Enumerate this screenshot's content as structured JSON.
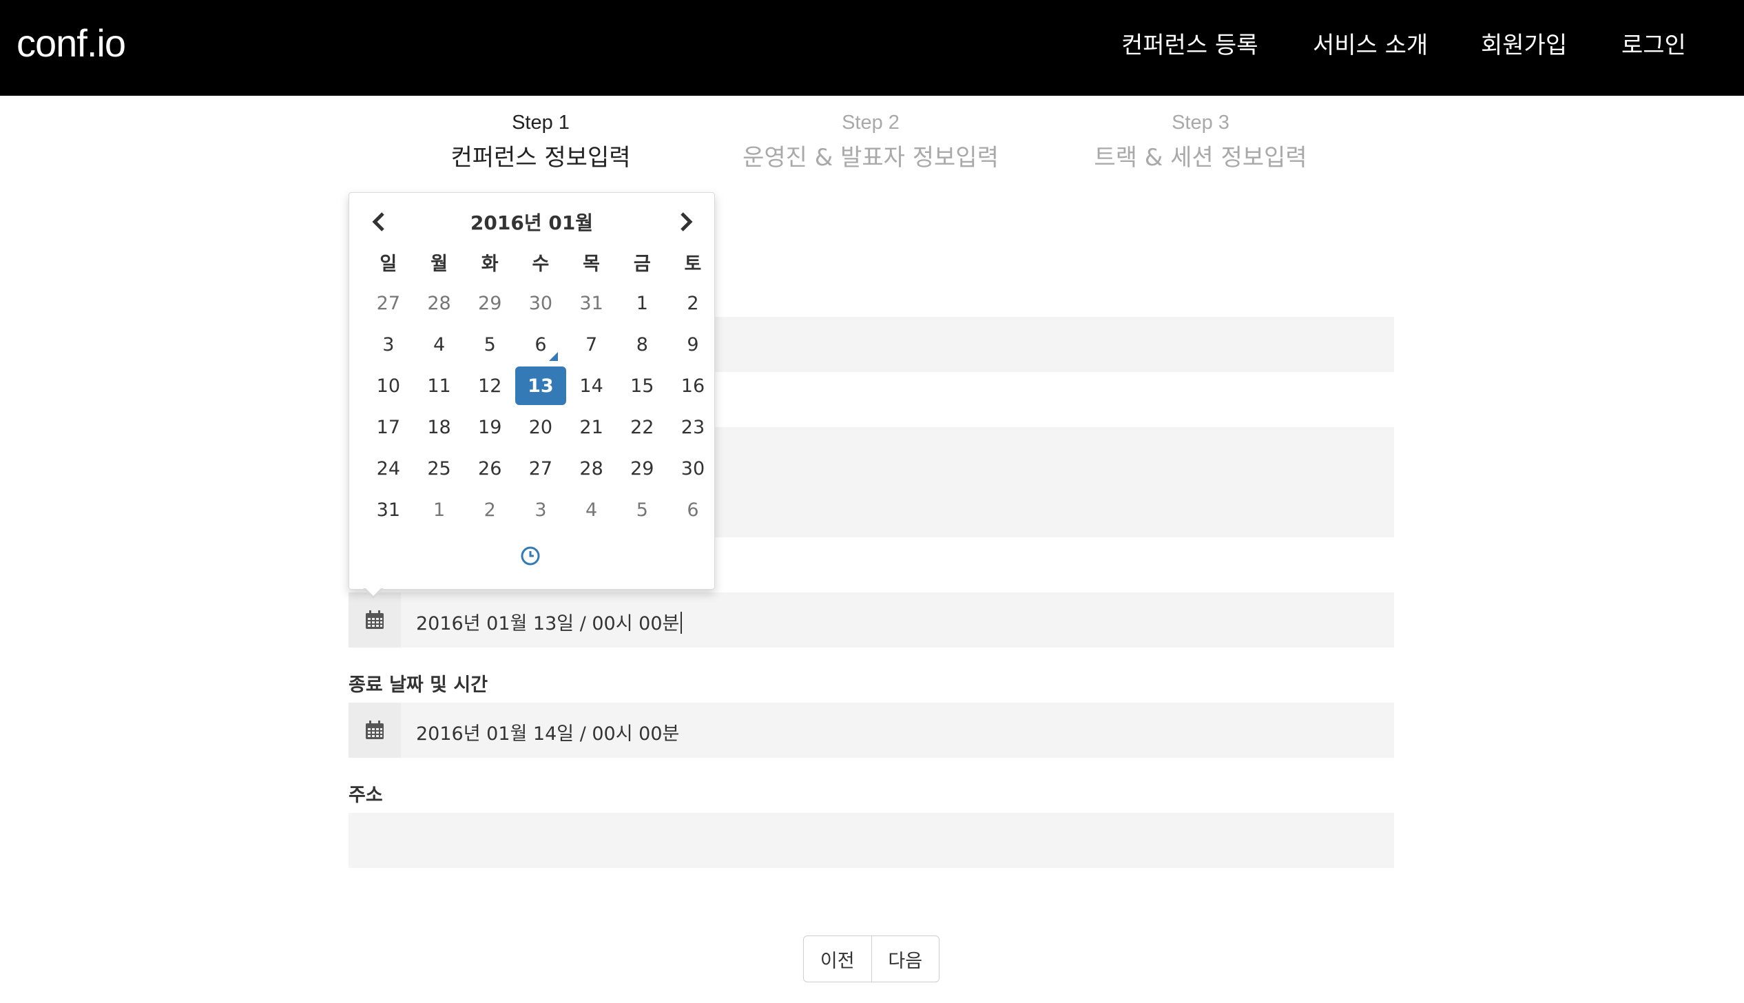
{
  "brand": "conf.io",
  "nav": {
    "items": [
      "컨퍼런스 등록",
      "서비스 소개",
      "회원가입",
      "로그인"
    ]
  },
  "steps": [
    {
      "num": "Step 1",
      "title": "컨퍼런스 정보입력",
      "active": true
    },
    {
      "num": "Step 2",
      "title": "운영진 & 발표자 정보입력",
      "active": false
    },
    {
      "num": "Step 3",
      "title": "트랙 & 세션 정보입력",
      "active": false
    }
  ],
  "form": {
    "start_value": "2016년 01월 13일 / 00시 00분",
    "end_label": "종료 날짜 및 시간",
    "end_value": "2016년 01월 14일 / 00시 00분",
    "address_label": "주소",
    "address_value": ""
  },
  "buttons": {
    "prev": "이전",
    "next": "다음"
  },
  "datepicker": {
    "title": "2016년 01월",
    "weekdays": [
      "일",
      "월",
      "화",
      "수",
      "목",
      "금",
      "토"
    ],
    "weeks": [
      [
        "27",
        "28",
        "29",
        "30",
        "31",
        "1",
        "2"
      ],
      [
        "3",
        "4",
        "5",
        "6",
        "7",
        "8",
        "9"
      ],
      [
        "10",
        "11",
        "12",
        "13",
        "14",
        "15",
        "16"
      ],
      [
        "17",
        "18",
        "19",
        "20",
        "21",
        "22",
        "23"
      ],
      [
        "24",
        "25",
        "26",
        "27",
        "28",
        "29",
        "30"
      ],
      [
        "31",
        "1",
        "2",
        "3",
        "4",
        "5",
        "6"
      ]
    ],
    "selected_day": "13",
    "today_day": "6",
    "icons": {
      "prev": "chevron-left-icon",
      "next": "chevron-right-icon",
      "time": "clock-icon"
    }
  },
  "colors": {
    "navbar": "#000000",
    "accent": "#337ab7",
    "field_bg": "#f4f4f4",
    "muted_text": "#a9a9a9"
  }
}
